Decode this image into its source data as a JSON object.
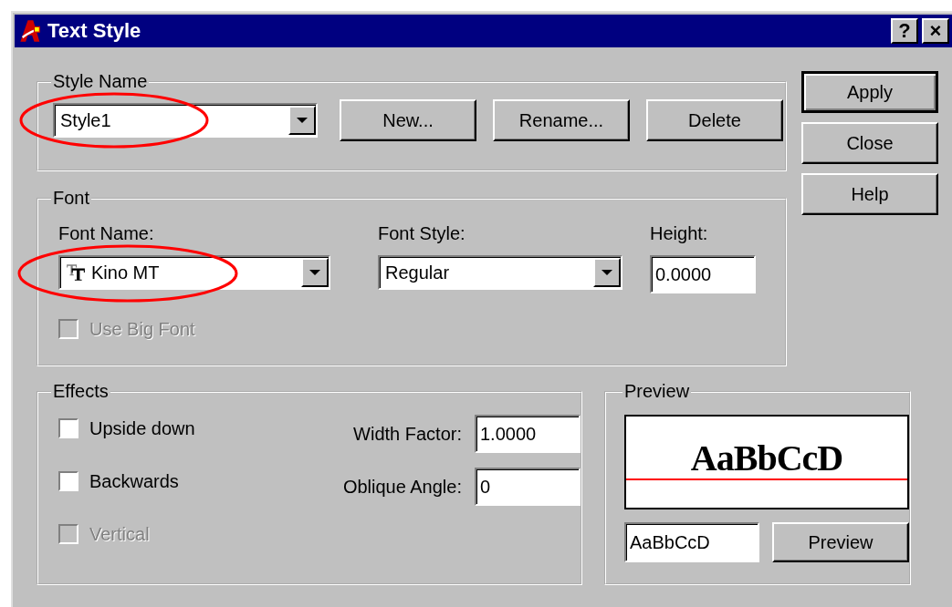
{
  "window": {
    "title": "Text Style",
    "title_buttons": [
      "?",
      "×"
    ]
  },
  "style_name": {
    "legend": "Style Name",
    "combo": {
      "value": "Style1",
      "circled": true
    },
    "buttons": [
      "New...",
      "Rename...",
      "Delete"
    ]
  },
  "side_buttons": [
    {
      "label": "Apply",
      "default": true
    },
    {
      "label": "Close",
      "default": false
    },
    {
      "label": "Help",
      "default": false
    }
  ],
  "font": {
    "legend": "Font",
    "font_name": {
      "label": "Font Name:",
      "value": "Kino MT",
      "circled": true
    },
    "font_style": {
      "label": "Font Style:",
      "value": "Regular"
    },
    "height": {
      "label": "Height:",
      "value": "0.0000"
    },
    "big_font": {
      "label": "Use Big Font",
      "checked": false,
      "disabled": true
    }
  },
  "effects": {
    "legend": "Effects",
    "checkboxes": [
      {
        "label": "Upside down",
        "checked": false,
        "disabled": false
      },
      {
        "label": "Backwards",
        "checked": false,
        "disabled": false
      },
      {
        "label": "Vertical",
        "checked": false,
        "disabled": true
      }
    ],
    "width_factor": {
      "label": "Width Factor:",
      "value": "1.0000"
    },
    "oblique_angle": {
      "label": "Oblique Angle:",
      "value": "0"
    }
  },
  "preview": {
    "legend": "Preview",
    "sample": "AaBbCcD",
    "input": "AaBbCcD",
    "button": "Preview"
  }
}
